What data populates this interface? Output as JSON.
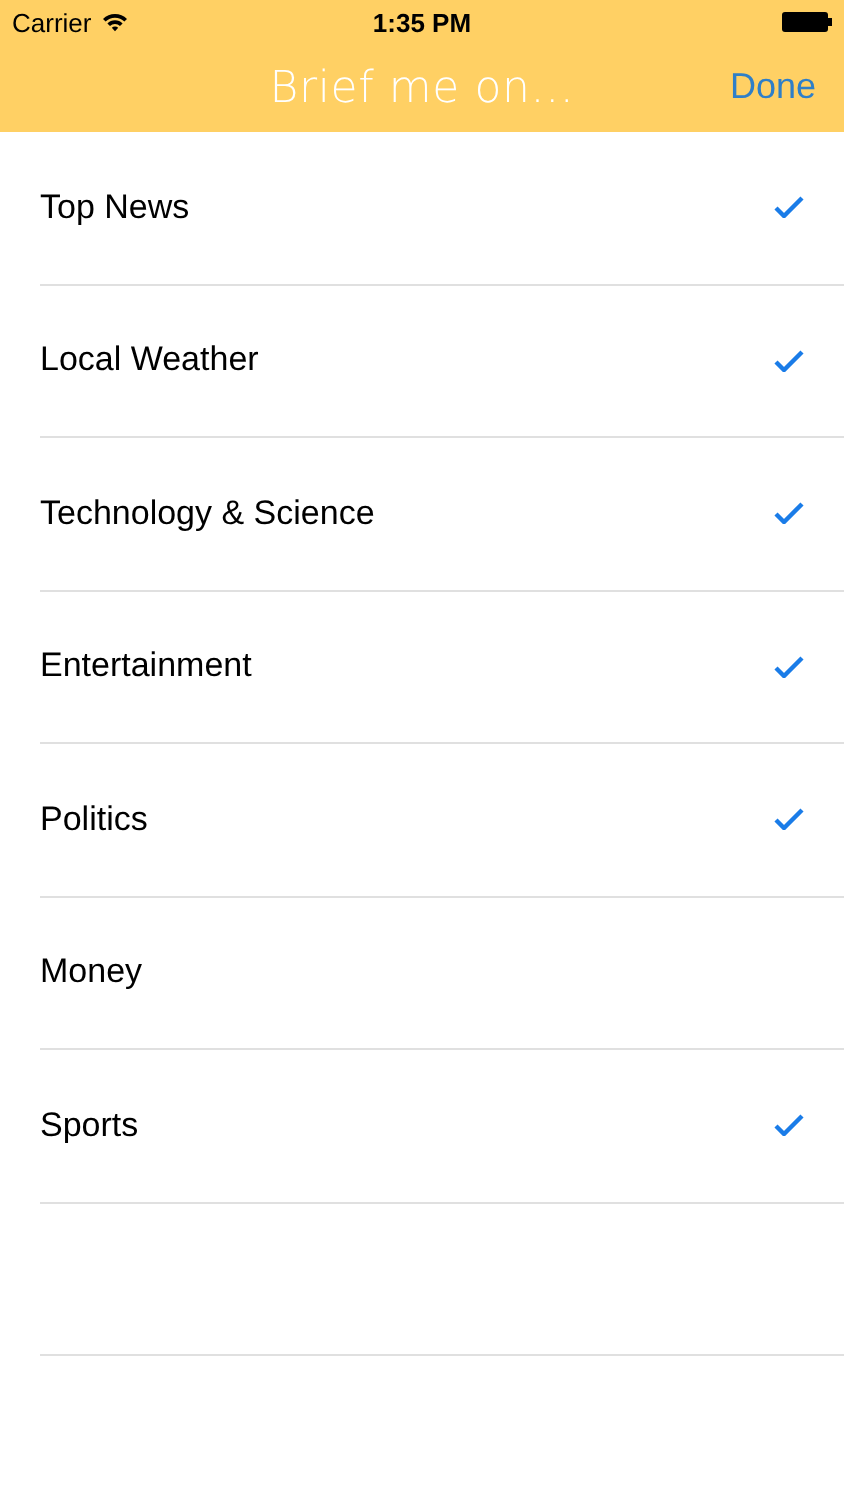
{
  "status_bar": {
    "carrier": "Carrier",
    "time": "1:35 PM"
  },
  "nav_bar": {
    "title": "Brief me on...",
    "done_button": "Done"
  },
  "topics": [
    {
      "label": "Top News",
      "checked": true
    },
    {
      "label": "Local Weather",
      "checked": true
    },
    {
      "label": "Technology & Science",
      "checked": true
    },
    {
      "label": "Entertainment",
      "checked": true
    },
    {
      "label": "Politics",
      "checked": true
    },
    {
      "label": "Money",
      "checked": false
    },
    {
      "label": "Sports",
      "checked": true
    }
  ]
}
